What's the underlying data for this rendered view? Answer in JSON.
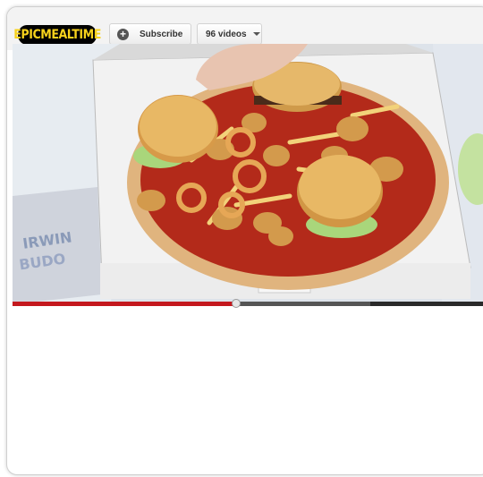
{
  "channel": {
    "logo_text": "EPICMEALTIME",
    "subscribe_label": "Subscribe",
    "videos_label": "96 videos"
  },
  "player": {
    "progress_played_fraction": 0.475,
    "progress_buffered_fraction": 0.76
  },
  "colors": {
    "progress_played": "#c4181e",
    "logo_text": "#f7d21c"
  },
  "icons": [
    "plus-circle-icon",
    "caret-down-icon"
  ]
}
